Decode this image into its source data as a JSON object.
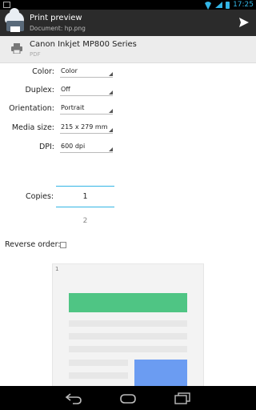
{
  "status_bar": {
    "time": "17:25",
    "icons": [
      "notification-icon",
      "wifi-icon",
      "signal-icon",
      "battery-icon"
    ]
  },
  "action_bar": {
    "title": "Print preview",
    "subtitle": "Document: hp.png",
    "action_icon": "send-icon"
  },
  "printer": {
    "name": "Canon Inkjet MP800 Series",
    "type": "PDF"
  },
  "settings": {
    "color": {
      "label": "Color:",
      "value": "Color"
    },
    "duplex": {
      "label": "Duplex:",
      "value": "Off"
    },
    "orientation": {
      "label": "Orientation:",
      "value": "Portrait"
    },
    "media_size": {
      "label": "Media size:",
      "value": "215 x 279 mm"
    },
    "dpi": {
      "label": "DPI:",
      "value": "600 dpi"
    },
    "copies": {
      "label": "Copies:",
      "value": "1"
    },
    "pages": {
      "value": "2"
    },
    "reverse_order": {
      "label": "Reverse order:",
      "checked": false
    }
  },
  "preview": {
    "page_number": "1"
  },
  "colors": {
    "accent": "#33b5e5",
    "green": "#4fc584",
    "blue": "#6b9cf2",
    "action_bar": "#2b2b2b"
  },
  "nav_bar": {
    "icons": [
      "back-icon",
      "home-icon",
      "recents-icon"
    ]
  }
}
